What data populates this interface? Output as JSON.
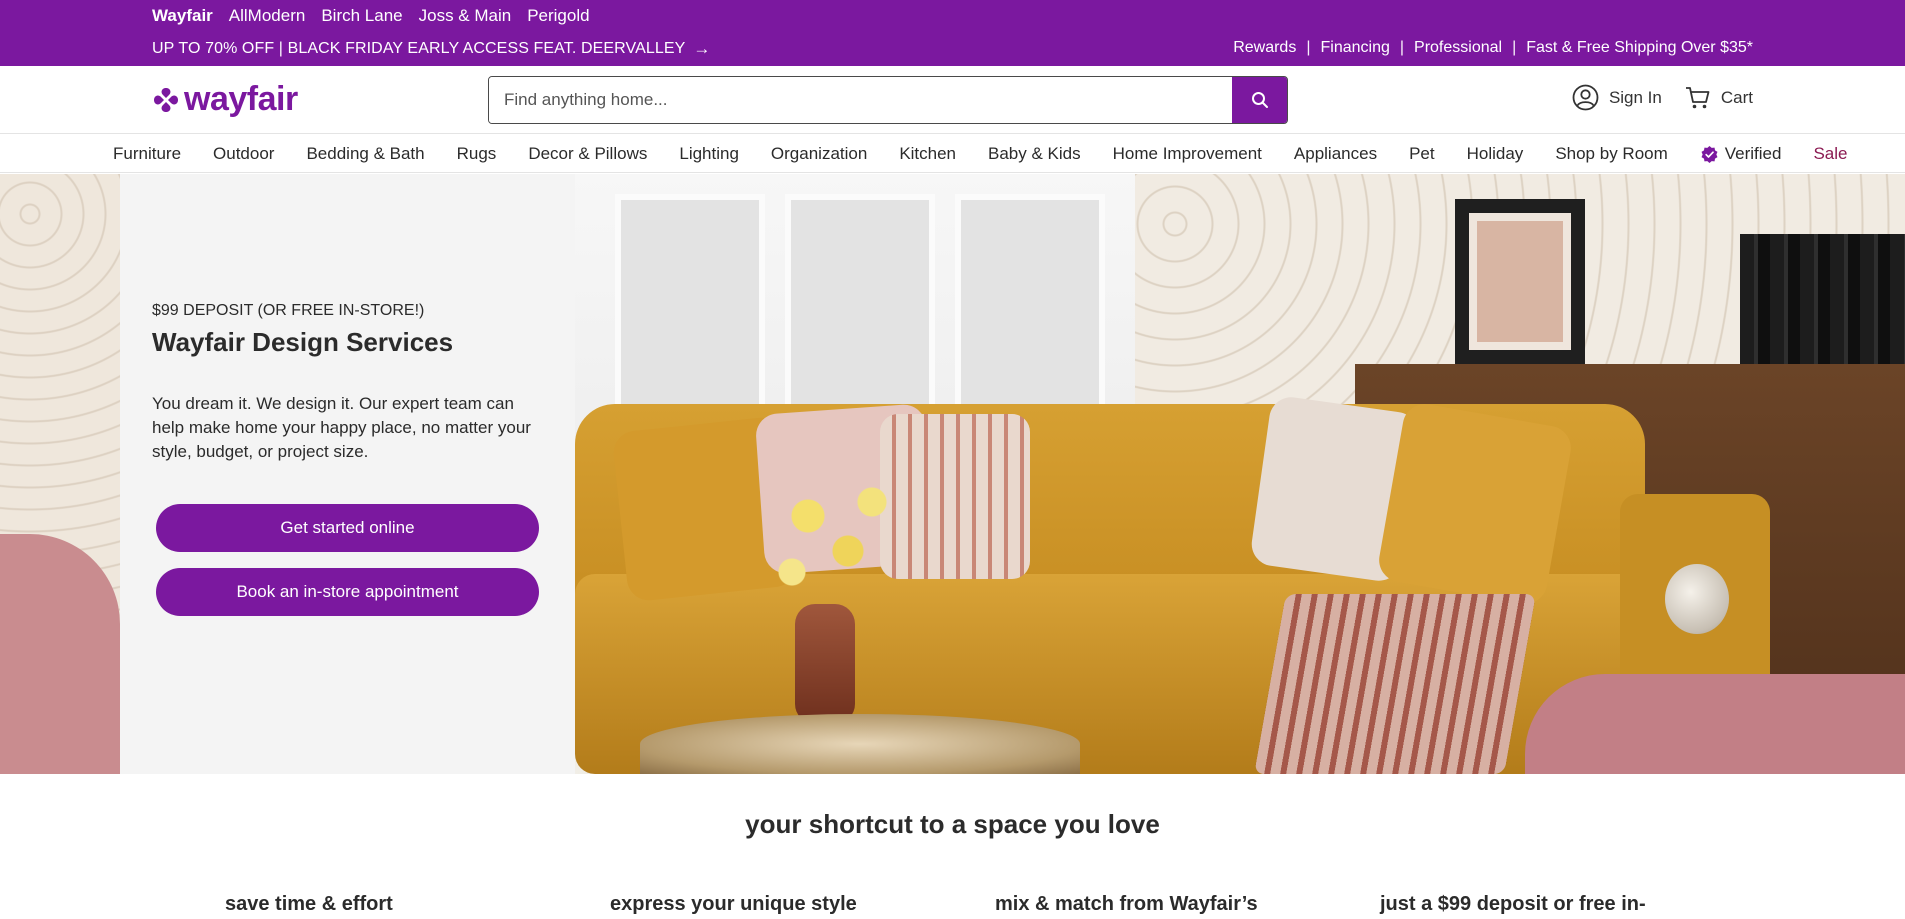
{
  "topbar": {
    "brands": [
      "Wayfair",
      "AllModern",
      "Birch Lane",
      "Joss & Main",
      "Perigold"
    ],
    "promo": "UP TO 70% OFF | BLACK FRIDAY EARLY ACCESS FEAT. DEERVALLEY",
    "utility_links": [
      "Rewards",
      "Financing",
      "Professional",
      "Fast & Free Shipping Over $35*"
    ]
  },
  "header": {
    "logo_text": "wayfair",
    "search_placeholder": "Find anything home...",
    "sign_in": "Sign In",
    "cart": "Cart"
  },
  "nav": {
    "items": [
      "Furniture",
      "Outdoor",
      "Bedding & Bath",
      "Rugs",
      "Decor & Pillows",
      "Lighting",
      "Organization",
      "Kitchen",
      "Baby & Kids",
      "Home Improvement",
      "Appliances",
      "Pet",
      "Holiday",
      "Shop by Room",
      "Verified",
      "Sale"
    ]
  },
  "hero": {
    "eyebrow": "$99 DEPOSIT (OR FREE IN-STORE!)",
    "title": "Wayfair Design Services",
    "description": "You dream it. We design it. Our expert team can help make home your happy place, no matter your style, budget, or project size.",
    "primary_button": "Get started online",
    "secondary_button": "Book an in-store appointment"
  },
  "section": {
    "heading": "your shortcut to a space you love",
    "features": [
      "save time & effort",
      "express your unique style",
      "mix & match from Wayfair’s",
      "just a $99 deposit or free in-"
    ]
  },
  "colors": {
    "brand_purple": "#7b189f",
    "sale_text": "#8b1a52",
    "panel_bg": "#f4f4f4"
  }
}
